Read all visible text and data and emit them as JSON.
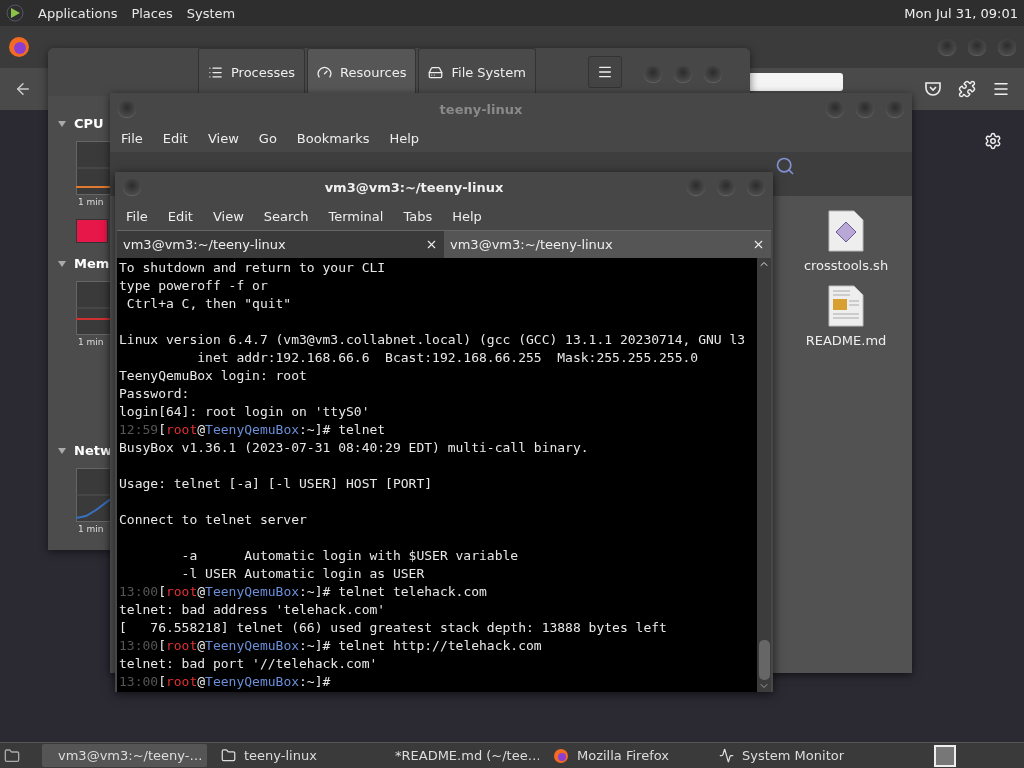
{
  "top_panel": {
    "menus": [
      "Applications",
      "Places",
      "System"
    ],
    "clock": "Mon Jul 31, 09:01"
  },
  "system_monitor": {
    "tabs": [
      {
        "label": "Processes",
        "kind": "processes",
        "selected": false
      },
      {
        "label": "Resources",
        "kind": "resources",
        "selected": true
      },
      {
        "label": "File System",
        "kind": "filesystem",
        "selected": false
      }
    ],
    "sections": [
      {
        "title": "CPU",
        "axis_label": "1 min",
        "swatch": {
          "color": "#e8174a"
        }
      },
      {
        "title": "Mem",
        "axis_label": "1 min"
      },
      {
        "title": "Netw",
        "axis_label": "1 min"
      }
    ]
  },
  "file_manager": {
    "title": "teeny-linux",
    "menus": [
      "File",
      "Edit",
      "View",
      "Go",
      "Bookmarks",
      "Help"
    ],
    "files": [
      {
        "name": "crosstools.sh",
        "kind": "script"
      },
      {
        "name": "README.md",
        "kind": "document"
      }
    ]
  },
  "terminal": {
    "title": "vm3@vm3:~/teeny-linux",
    "menus": [
      "File",
      "Edit",
      "View",
      "Search",
      "Terminal",
      "Tabs",
      "Help"
    ],
    "tabs": [
      {
        "label": "vm3@vm3:~/teeny-linux",
        "selected": true
      },
      {
        "label": "vm3@vm3:~/teeny-linux",
        "selected": false
      }
    ],
    "lines": [
      {
        "kind": "text",
        "text": "To shutdown and return to your CLI"
      },
      {
        "kind": "text",
        "text": "type poweroff -f or"
      },
      {
        "kind": "text",
        "text": " Ctrl+a C, then \"quit\""
      },
      {
        "kind": "blank"
      },
      {
        "kind": "text",
        "text": "Linux version 6.4.7 (vm3@vm3.collabnet.local) (gcc (GCC) 13.1.1 20230714, GNU l3"
      },
      {
        "kind": "text",
        "text": "          inet addr:192.168.66.6  Bcast:192.168.66.255  Mask:255.255.255.0"
      },
      {
        "kind": "text",
        "text": "TeenyQemuBox login: root"
      },
      {
        "kind": "text",
        "text": "Password:"
      },
      {
        "kind": "text",
        "text": "login[64]: root login on 'ttyS0'"
      },
      {
        "kind": "prompt",
        "parts": [
          {
            "text": "12:59",
            "color": "#555555"
          },
          {
            "text": "["
          },
          {
            "text": "root",
            "color": "#e03030"
          },
          {
            "text": "@"
          },
          {
            "text": "TeenyQemuBox",
            "color": "#6a8ed8"
          },
          {
            "text": ":~]# telnet"
          }
        ]
      },
      {
        "kind": "text",
        "text": "BusyBox v1.36.1 (2023-07-31 08:40:29 EDT) multi-call binary."
      },
      {
        "kind": "blank"
      },
      {
        "kind": "text",
        "text": "Usage: telnet [-a] [-l USER] HOST [PORT]"
      },
      {
        "kind": "blank"
      },
      {
        "kind": "text",
        "text": "Connect to telnet server"
      },
      {
        "kind": "blank"
      },
      {
        "kind": "text",
        "text": "        -a      Automatic login with $USER variable"
      },
      {
        "kind": "text",
        "text": "        -l USER Automatic login as USER"
      },
      {
        "kind": "prompt",
        "parts": [
          {
            "text": "13:00",
            "color": "#555555"
          },
          {
            "text": "["
          },
          {
            "text": "root",
            "color": "#e03030"
          },
          {
            "text": "@"
          },
          {
            "text": "TeenyQemuBox",
            "color": "#6a8ed8"
          },
          {
            "text": ":~]# telnet telehack.com"
          }
        ]
      },
      {
        "kind": "text",
        "text": "telnet: bad address 'telehack.com'"
      },
      {
        "kind": "text",
        "text": "[   76.558218] telnet (66) used greatest stack depth: 13888 bytes left"
      },
      {
        "kind": "prompt",
        "parts": [
          {
            "text": "13:00",
            "color": "#555555"
          },
          {
            "text": "["
          },
          {
            "text": "root",
            "color": "#e03030"
          },
          {
            "text": "@"
          },
          {
            "text": "TeenyQemuBox",
            "color": "#6a8ed8"
          },
          {
            "text": ":~]# telnet http://telehack.com"
          }
        ]
      },
      {
        "kind": "text",
        "text": "telnet: bad port '//telehack.com'"
      },
      {
        "kind": "prompt",
        "parts": [
          {
            "text": "13:00",
            "color": "#555555"
          },
          {
            "text": "["
          },
          {
            "text": "root",
            "color": "#e03030"
          },
          {
            "text": "@"
          },
          {
            "text": "TeenyQemuBox",
            "color": "#6a8ed8"
          },
          {
            "text": ":~]#"
          }
        ]
      }
    ]
  },
  "taskbar": {
    "items": [
      {
        "label": "vm3@vm3:~/teeny-…",
        "kind": "terminal",
        "selected": true
      },
      {
        "label": "teeny-linux",
        "kind": "folder",
        "selected": false
      },
      {
        "label": "*README.md (~/tee…",
        "kind": "editor",
        "selected": false
      },
      {
        "label": "Mozilla Firefox",
        "kind": "browser",
        "selected": false
      },
      {
        "label": "System Monitor",
        "kind": "monitor",
        "selected": false
      }
    ]
  }
}
